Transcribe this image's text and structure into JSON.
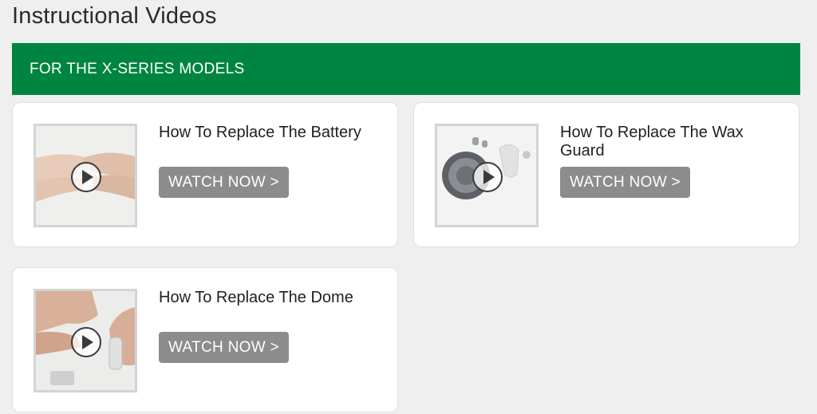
{
  "page": {
    "title": "Instructional Videos"
  },
  "banner": {
    "label": "FOR THE X-SERIES MODELS",
    "color": "#008540"
  },
  "videos": [
    {
      "title": "How To Replace The Battery",
      "button": "WATCH NOW >",
      "thumbnail_icon": "hands-battery-thumbnail"
    },
    {
      "title": "How To Replace The Wax Guard",
      "button": "WATCH NOW >",
      "thumbnail_icon": "wax-guard-thumbnail"
    },
    {
      "title": "How To Replace The Dome",
      "button": "WATCH NOW >",
      "thumbnail_icon": "hands-dome-thumbnail"
    }
  ],
  "colors": {
    "button": "#8c8c8c",
    "card": "#ffffff",
    "background": "#efefef"
  }
}
